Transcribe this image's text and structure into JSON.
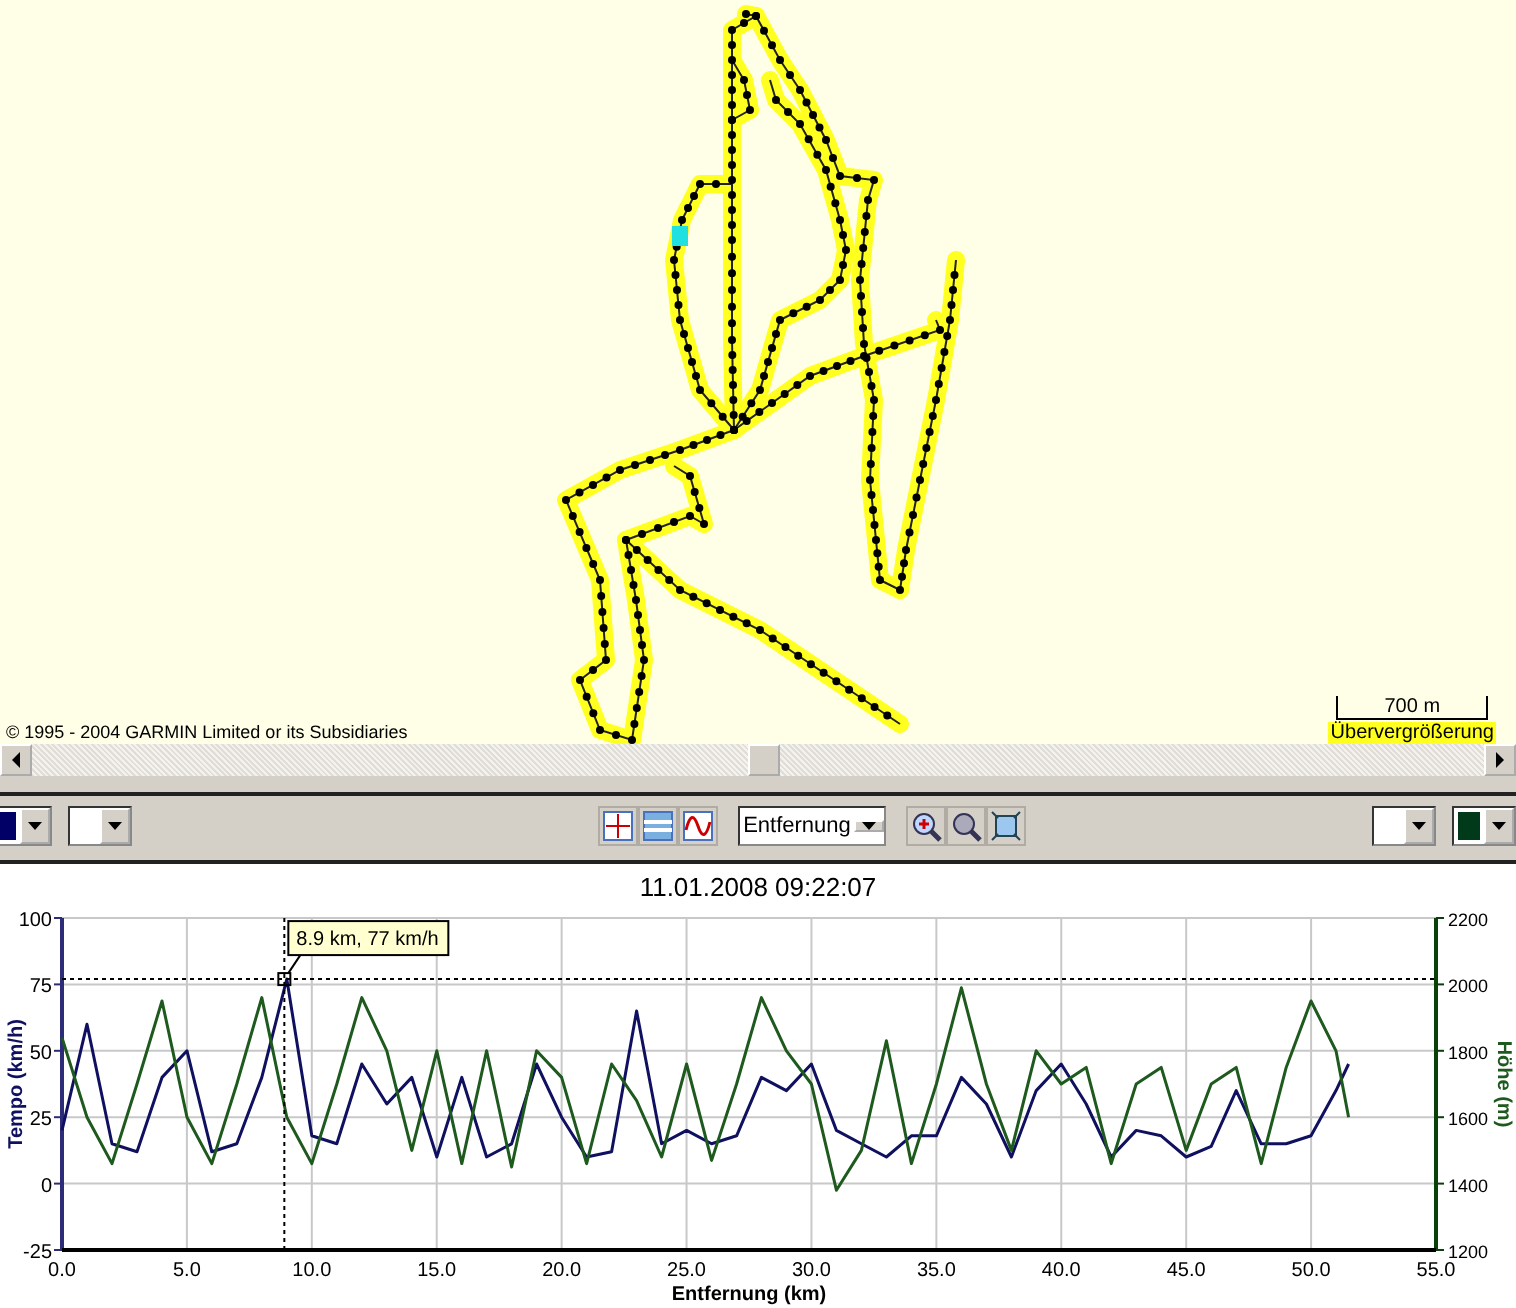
{
  "map": {
    "copyright": "© 1995 - 2004 GARMIN Limited or its Subsidiaries",
    "scale": "700 m",
    "zoom_note": "Übervergrößerung"
  },
  "toolbar": {
    "left_swatches": [
      {
        "color": "#000066"
      },
      {
        "color": "#ffffff"
      }
    ],
    "axis_select": "Entfernung",
    "right_swatches": [
      {
        "color": "#ffffff"
      },
      {
        "color": "#003a1a"
      }
    ]
  },
  "chart": {
    "chart_data": {
      "type": "line",
      "title": "11.01.2008 09:22:07",
      "xlabel": "Entfernung (km)",
      "ylabel": "Tempo (km/h)",
      "y2label": "Höhe (m)",
      "x": [
        0,
        1,
        2,
        3,
        4,
        5,
        6,
        7,
        8,
        9,
        10,
        11,
        12,
        13,
        14,
        15,
        16,
        17,
        18,
        19,
        20,
        21,
        22,
        23,
        24,
        25,
        26,
        27,
        28,
        29,
        30,
        31,
        32,
        33,
        34,
        35,
        36,
        37,
        38,
        39,
        40,
        41,
        42,
        43,
        44,
        45,
        46,
        47,
        48,
        49,
        50,
        51,
        51.5
      ],
      "series": [
        {
          "color": "#101060",
          "values": [
            20,
            60,
            15,
            12,
            40,
            50,
            12,
            15,
            40,
            77,
            18,
            15,
            45,
            30,
            40,
            10,
            40,
            10,
            15,
            45,
            25,
            10,
            12,
            65,
            15,
            20,
            15,
            18,
            40,
            35,
            45,
            20,
            15,
            10,
            18,
            18,
            40,
            30,
            10,
            35,
            45,
            30,
            10,
            20,
            18,
            10,
            14,
            35,
            15,
            15,
            18,
            35,
            45
          ]
        },
        {
          "color": "#1e5a1e",
          "axis": "y2",
          "values": [
            1840,
            1600,
            1460,
            1700,
            1950,
            1600,
            1460,
            1700,
            1960,
            1600,
            1460,
            1700,
            1960,
            1800,
            1500,
            1800,
            1460,
            1800,
            1450,
            1800,
            1720,
            1460,
            1760,
            1650,
            1480,
            1760,
            1470,
            1700,
            1960,
            1800,
            1700,
            1380,
            1500,
            1830,
            1460,
            1700,
            1990,
            1700,
            1500,
            1800,
            1700,
            1750,
            1460,
            1700,
            1750,
            1500,
            1700,
            1750,
            1460,
            1750,
            1950,
            1800,
            1600
          ]
        }
      ],
      "xlim": [
        0,
        55
      ],
      "ylim": [
        -25,
        100
      ],
      "y2lim": [
        1200,
        2200
      ],
      "xticks": [
        {
          "value": 0,
          "label": "0.0"
        },
        {
          "value": 5,
          "label": "5.0"
        },
        {
          "value": 10,
          "label": "10.0"
        },
        {
          "value": 15,
          "label": "15.0"
        },
        {
          "value": 20,
          "label": "20.0"
        },
        {
          "value": 25,
          "label": "25.0"
        },
        {
          "value": 30,
          "label": "30.0"
        },
        {
          "value": 35,
          "label": "35.0"
        },
        {
          "value": 40,
          "label": "40.0"
        },
        {
          "value": 45,
          "label": "45.0"
        },
        {
          "value": 50,
          "label": "50.0"
        },
        {
          "value": 55,
          "label": "55.0"
        }
      ],
      "yticks": [
        -25,
        0,
        25,
        50,
        75,
        100
      ],
      "y2ticks": [
        1200,
        1400,
        1600,
        1800,
        2000,
        2200
      ],
      "grid": true,
      "ref_lines": [
        {
          "axis": "x",
          "value": 8.9
        },
        {
          "axis": "y",
          "value": 77
        }
      ],
      "annotations": [
        {
          "x": 8.9,
          "y": 77,
          "text": "8.9 km, 77 km/h"
        }
      ]
    }
  }
}
